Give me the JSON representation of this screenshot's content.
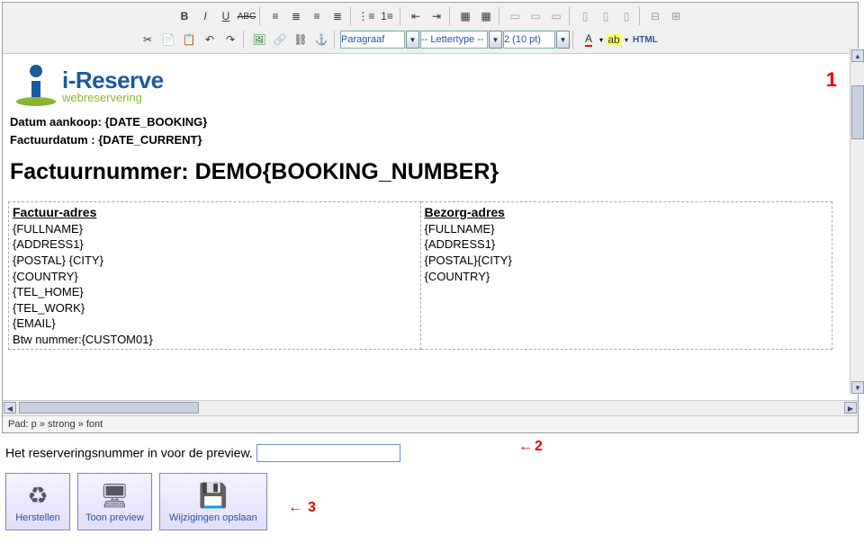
{
  "toolbar": {
    "paragraaf": "Paragraaf",
    "lettertype": "-- Lettertype --",
    "fontsize": "2 (10 pt)",
    "html_label": "HTML"
  },
  "logo": {
    "line1": "i-Reserve",
    "line2": "webreservering"
  },
  "meta": {
    "line1": "Datum aankoop: {DATE_BOOKING}",
    "line2": "Factuurdatum : {DATE_CURRENT}"
  },
  "invoice_title": "Factuurnummer: DEMO{BOOKING_NUMBER}",
  "addresses": {
    "billing": {
      "header": "Factuur-adres",
      "lines": [
        "{FULLNAME}",
        "{ADDRESS1}",
        "{POSTAL} {CITY}",
        "{COUNTRY}",
        "{TEL_HOME}",
        "{TEL_WORK}",
        "{EMAIL}",
        "Btw nummer:{CUSTOM01}"
      ]
    },
    "delivery": {
      "header": "Bezorg-adres",
      "lines": [
        "{FULLNAME}",
        "{ADDRESS1}",
        "{POSTAL}{CITY}",
        "{COUNTRY}"
      ]
    }
  },
  "path_bar": "Pad: p » strong » font",
  "preview": {
    "label": "Het reserveringsnummer in voor de preview.",
    "value": ""
  },
  "buttons": {
    "restore": "Herstellen",
    "preview": "Toon preview",
    "save": "Wijzigingen opslaan"
  },
  "annotations": {
    "a1": "1",
    "a2": "2",
    "a3": "3"
  }
}
